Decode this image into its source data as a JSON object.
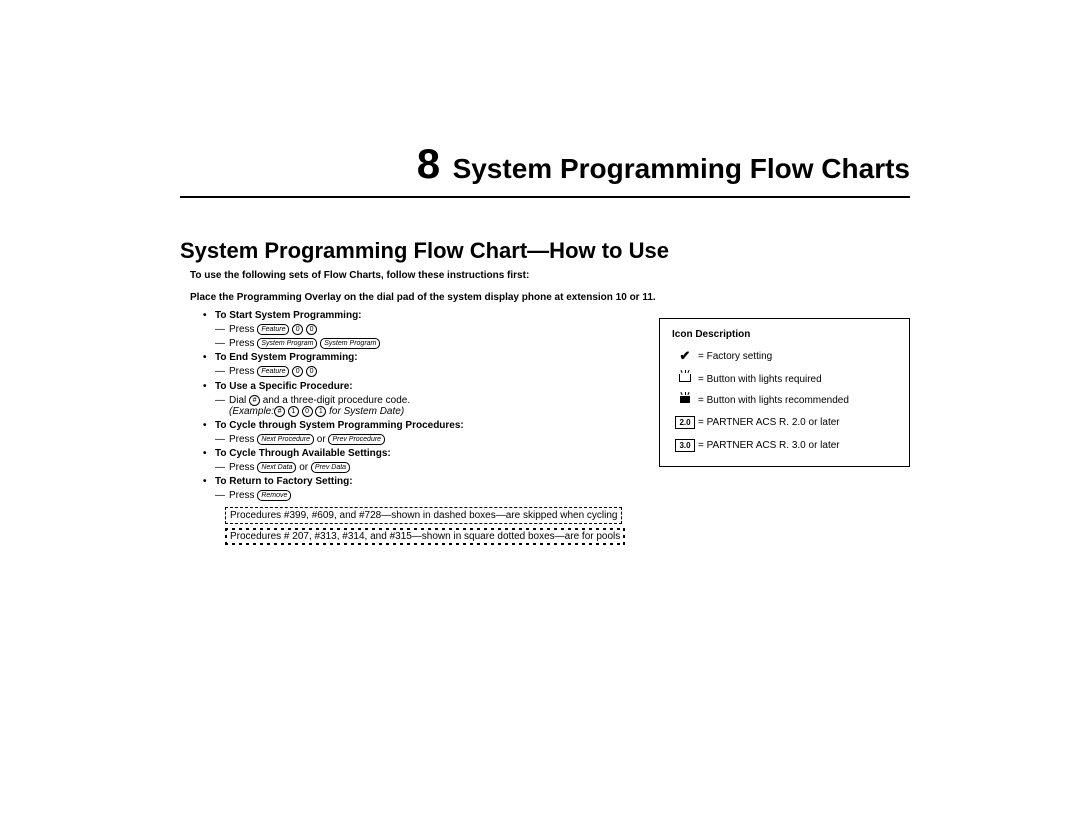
{
  "chapter": {
    "num": "8",
    "title": "System Programming Flow Charts"
  },
  "section_title": "System Programming Flow Chart—How to Use",
  "intro": "To use the following sets of Flow Charts, follow these instructions first:",
  "overlay_note": "Place the Programming Overlay on the dial pad of the system display phone at extension 10 or 11.",
  "items": {
    "start": {
      "label": "To Start System Programming:",
      "line1_prefix": "Press ",
      "line2_prefix": "Press "
    },
    "end": {
      "label": "To End System Programming:",
      "line1_prefix": "Press "
    },
    "specific": {
      "label": "To Use a Specific Procedure:",
      "line1_prefix": "Dial ",
      "line1_suffix": " and a three-digit procedure code.",
      "example_prefix": "(Example:",
      "example_suffix": " for System Date)"
    },
    "cycle_proc": {
      "label": "To Cycle through System Programming Procedures:",
      "line1_prefix": "Press ",
      "or": " or "
    },
    "cycle_set": {
      "label": "To Cycle Through Available Settings:",
      "line1_prefix": "Press ",
      "or": " or "
    },
    "factory": {
      "label": "To Return to Factory Setting:",
      "line1_prefix": "Press "
    }
  },
  "keys": {
    "feature": "Feature",
    "zero": "0",
    "sysprog": "System Program",
    "hash": "#",
    "one": "1",
    "nextproc": "Next Procedure",
    "prevproc": "Prev Procedure",
    "nextdata": "Next Data",
    "prevdata": "Prev Data",
    "remove": "Remove"
  },
  "icon_box": {
    "title": "Icon Description",
    "factory": "= Factory setting",
    "lights_req": "= Button with lights required",
    "lights_rec": "= Button with lights recommended",
    "v20_box": "2.0",
    "v20": "= PARTNER ACS R. 2.0 or later",
    "v30_box": "3.0",
    "v30": "= PARTNER ACS R. 3.0 or later"
  },
  "notes": {
    "dashed": "Procedures #399, #609, and #728—shown in dashed boxes—are skipped when cycling",
    "dotted": "Procedures # 207, #313, #314, and #315—shown in square dotted boxes—are for pools"
  }
}
